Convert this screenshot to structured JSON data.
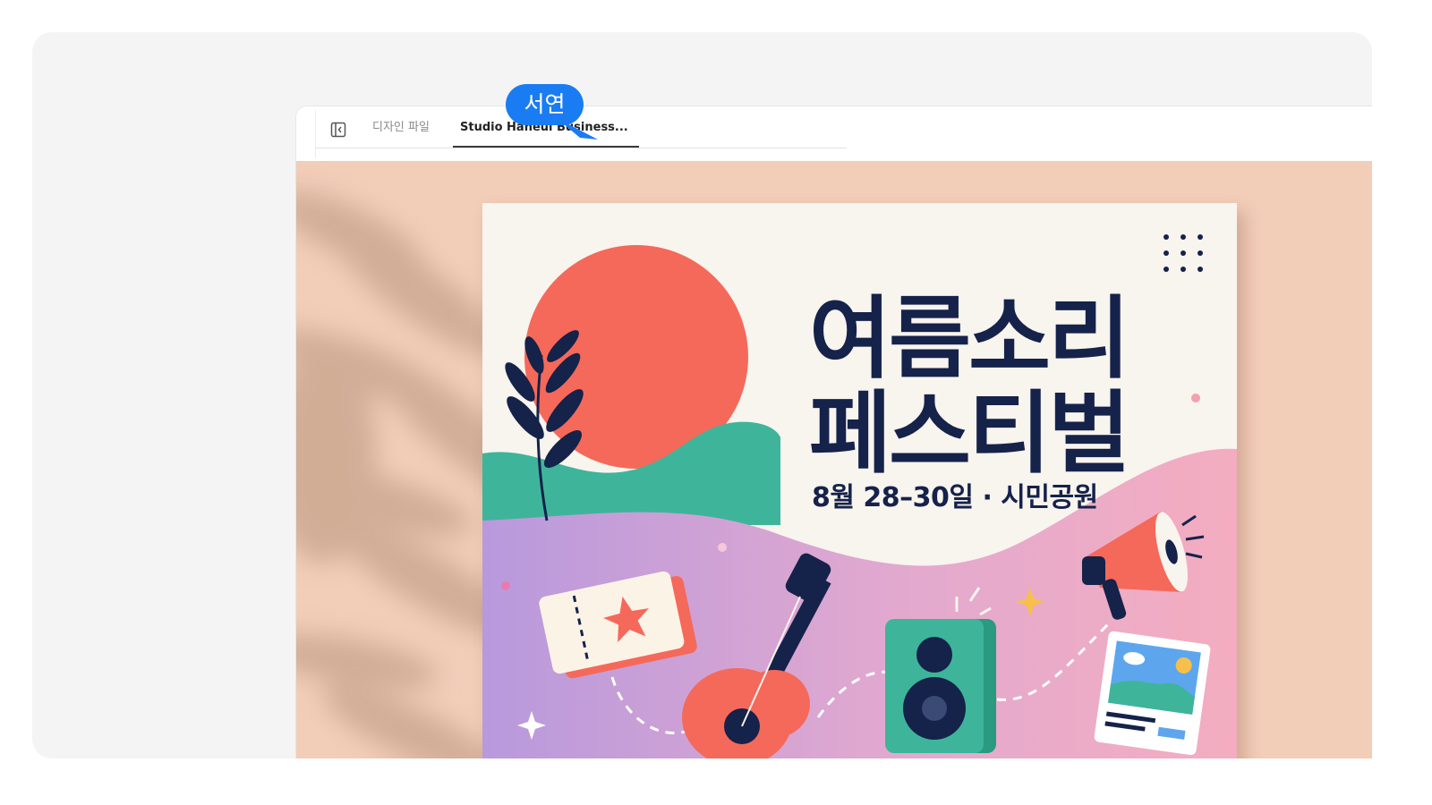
{
  "tabs": [
    {
      "label": "디자인 파일",
      "active": false
    },
    {
      "label": "Studio Haneul Business...",
      "active": true
    }
  ],
  "presence": {
    "name": "서연",
    "color": "#1a7cf3"
  },
  "poster": {
    "title_line1": "여름소리",
    "title_line2": "페스티벌",
    "subtitle": "8월 28–30일 · 시민공원",
    "colors": {
      "navy": "#15224a",
      "coral": "#f5695a",
      "teal": "#3eb59a",
      "purple": "#b899dc",
      "pink": "#f2a9c2",
      "background": "#f8f4ee"
    },
    "icons": [
      "sun-icon",
      "leaf-branch-icon",
      "ticket-icon",
      "guitar-icon",
      "speaker-icon",
      "megaphone-icon",
      "photo-card-icon",
      "sparkle-icon",
      "dot-grid-icon"
    ]
  },
  "icons": {
    "sidebar_toggle": "sidebar-toggle-icon"
  }
}
